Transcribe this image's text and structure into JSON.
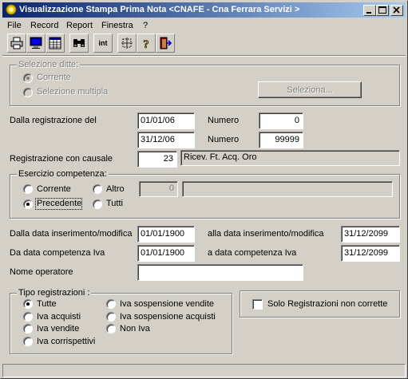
{
  "window": {
    "title": "Visualizzazione Stampa Prima Nota <CNAFE - Cna Ferrara Servizi >",
    "controls": {
      "minimize": "_",
      "maximize": "□",
      "close": "×"
    }
  },
  "menu": {
    "items": [
      "File",
      "Record",
      "Report",
      "Finestra",
      "?"
    ]
  },
  "toolbar": {
    "icons": [
      "printer-icon",
      "monitor-icon",
      "grid-icon",
      "binoculars-icon",
      "int-icon",
      "select-area-icon",
      "help-icon",
      "exit-icon"
    ],
    "int_label": "int"
  },
  "selezione_ditte": {
    "legend": "Selezione ditte:",
    "corrente": "Corrente",
    "multipla": "Selezione multipla",
    "selected": "Corrente",
    "button_label": "Seleziona..."
  },
  "registrazione": {
    "dalla_label": "Dalla registrazione  del",
    "date_from": "01/01/06",
    "date_to": "31/12/06",
    "numero_label": "Numero",
    "numero_from": "0",
    "numero_to": "99999"
  },
  "causale": {
    "label": "Registrazione con causale",
    "code": "23",
    "description": "Ricev. Ft. Acq. Oro"
  },
  "esercizio": {
    "legend": "Esercizio competenza:",
    "options": [
      "Corrente",
      "Altro",
      "Precedente",
      "Tutti"
    ],
    "selected": "Precedente",
    "altro_value": "0",
    "altro_desc": ""
  },
  "date_inserimento": {
    "from_label": "Dalla data inserimento/modifica",
    "from_value": "01/01/1900",
    "to_label": "alla data inserimento/modifica",
    "to_value": "31/12/2099"
  },
  "date_competenza_iva": {
    "from_label": "Da data competenza Iva",
    "from_value": "01/01/1900",
    "to_label": "a data competenza Iva",
    "to_value": "31/12/2099"
  },
  "operatore": {
    "label": "Nome operatore",
    "value": ""
  },
  "tipo_registrazioni": {
    "legend": "Tipo registrazioni :",
    "options": [
      "Tutte",
      "Iva acquisti",
      "Iva vendite",
      "Iva corrispettivi",
      "Iva sospensione vendite",
      "Iva sospensione acquisti",
      "Non Iva"
    ],
    "selected": "Tutte"
  },
  "non_corrette": {
    "label": "Solo Registrazioni non corrette",
    "checked": false
  },
  "colors": {
    "title_start": "#0a246a",
    "title_end": "#a6caf0",
    "face": "#d4d0c8"
  }
}
